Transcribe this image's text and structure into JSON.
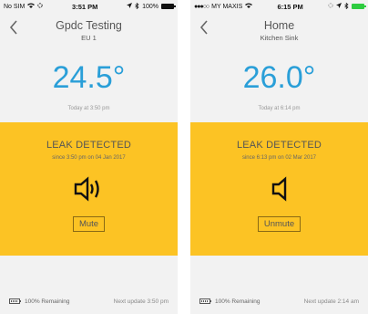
{
  "phones": [
    {
      "status": {
        "carrier": "No SIM",
        "time": "3:51 PM",
        "battery_text": "100%",
        "battery_level": 1.0
      },
      "nav": {
        "title": "Gpdc Testing",
        "subtitle": "EU 1"
      },
      "temperature": {
        "value": "24.5°",
        "time": "Today at 3:50 pm"
      },
      "alert": {
        "title": "LEAK DETECTED",
        "since": "since 3:50 pm on 04 Jan 2017",
        "speaker_icon": "speaker-sound-icon",
        "button_label": "Mute"
      },
      "footer": {
        "battery_remaining": "100% Remaining",
        "next_update": "Next update 3:50 pm"
      }
    },
    {
      "status": {
        "carrier": "MY MAXIS",
        "time": "6:15 PM",
        "battery_level": 1.0
      },
      "nav": {
        "title": "Home",
        "subtitle": "Kitchen Sink"
      },
      "temperature": {
        "value": "26.0°",
        "time": "Today at 6:14 pm"
      },
      "alert": {
        "title": "LEAK DETECTED",
        "since": "since 6:13 pm on 02 Mar 2017",
        "speaker_icon": "speaker-muted-icon",
        "button_label": "Unmute"
      },
      "footer": {
        "battery_remaining": "100% Remaining",
        "next_update": "Next update 2:14 am"
      }
    }
  ],
  "colors": {
    "temperature": "#2a9fd8",
    "alert_bg": "#fcc324",
    "battery_green": "#2ecc40"
  }
}
